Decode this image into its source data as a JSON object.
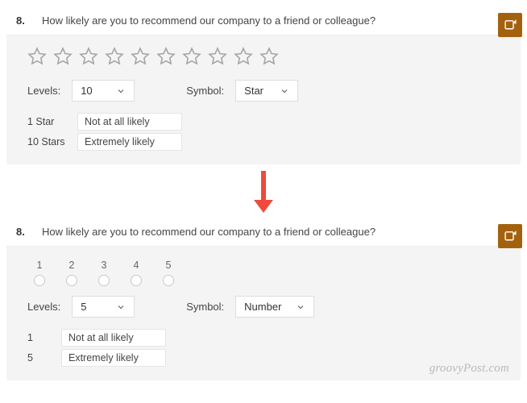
{
  "question_number": "8.",
  "question_text": "How likely are you to recommend our company to a friend or colleague?",
  "top": {
    "star_count": 10,
    "levels_label": "Levels:",
    "levels_value": "10",
    "symbol_label": "Symbol:",
    "symbol_value": "Star",
    "label_low_key": "1 Star",
    "label_low_value": "Not at all likely",
    "label_high_key": "10 Stars",
    "label_high_value": "Extremely likely"
  },
  "bottom": {
    "numbers": [
      "1",
      "2",
      "3",
      "4",
      "5"
    ],
    "levels_label": "Levels:",
    "levels_value": "5",
    "symbol_label": "Symbol:",
    "symbol_value": "Number",
    "label_low_key": "1",
    "label_low_value": "Not at all likely",
    "label_high_key": "5",
    "label_high_value": "Extremely likely"
  },
  "watermark": "groovyPost.com",
  "icons": {
    "branch": "branch-icon",
    "star": "star-icon",
    "chevron": "chevron-down-icon",
    "arrow": "arrow-down-icon"
  },
  "colors": {
    "branch_bg": "#a4610d",
    "arrow": "#ef4a3d",
    "star_stroke": "#a6a6a6"
  }
}
